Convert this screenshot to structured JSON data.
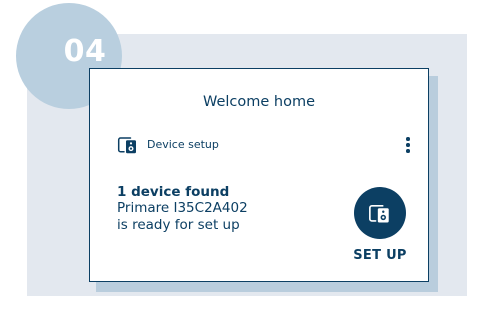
{
  "step": {
    "number": "04"
  },
  "card": {
    "title": "Welcome home",
    "setup_row": {
      "icon": "speaker-device-icon",
      "label": "Device setup"
    },
    "menu_icon": "more-vertical-icon",
    "status": {
      "heading": "1 device found",
      "device_line": "Primare I35C2A402",
      "message_line": "is ready for set up"
    },
    "setup_action": {
      "icon": "speaker-device-icon",
      "label": "SET UP"
    }
  },
  "colors": {
    "primary": "#0c3f63",
    "badge": "#b9cfdf",
    "panel_bg": "#e3e8ef",
    "card_shadow": "#b9cddd",
    "card_bg": "#ffffff"
  }
}
